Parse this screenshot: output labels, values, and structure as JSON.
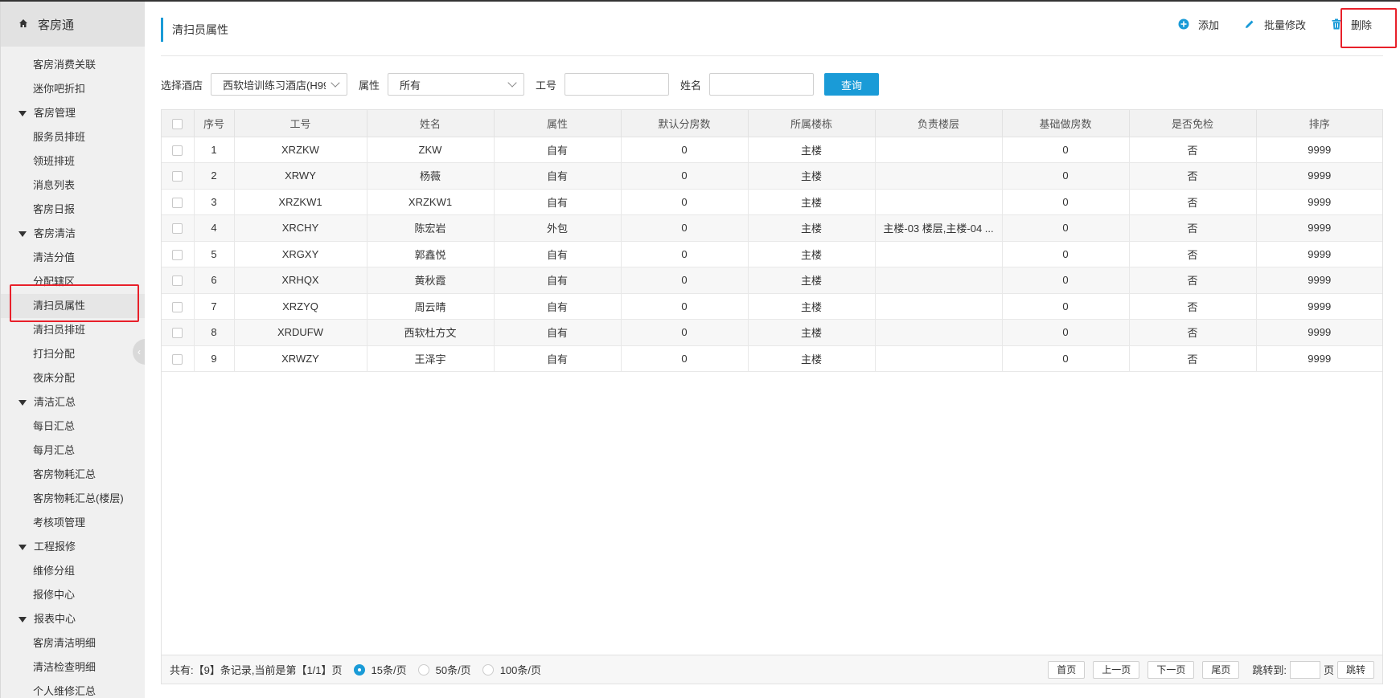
{
  "app": {
    "title": "客房通"
  },
  "sidebar": {
    "entries": [
      {
        "type": "item",
        "label": "客房消费关联"
      },
      {
        "type": "item",
        "label": "迷你吧折扣"
      },
      {
        "type": "group",
        "label": "客房管理"
      },
      {
        "type": "item",
        "label": "服务员排班"
      },
      {
        "type": "item",
        "label": "领班排班"
      },
      {
        "type": "item",
        "label": "消息列表"
      },
      {
        "type": "item",
        "label": "客房日报"
      },
      {
        "type": "group",
        "label": "客房清洁"
      },
      {
        "type": "item",
        "label": "清洁分值"
      },
      {
        "type": "item",
        "label": "分配辖区"
      },
      {
        "type": "item",
        "label": "清扫员属性",
        "active": true
      },
      {
        "type": "item",
        "label": "清扫员排班"
      },
      {
        "type": "item",
        "label": "打扫分配"
      },
      {
        "type": "item",
        "label": "夜床分配"
      },
      {
        "type": "group",
        "label": "清洁汇总"
      },
      {
        "type": "item",
        "label": "每日汇总"
      },
      {
        "type": "item",
        "label": "每月汇总"
      },
      {
        "type": "item",
        "label": "客房物耗汇总"
      },
      {
        "type": "item",
        "label": "客房物耗汇总(楼层)"
      },
      {
        "type": "item",
        "label": "考核项管理"
      },
      {
        "type": "group",
        "label": "工程报修"
      },
      {
        "type": "item",
        "label": "维修分组"
      },
      {
        "type": "item",
        "label": "报修中心"
      },
      {
        "type": "group",
        "label": "报表中心"
      },
      {
        "type": "item",
        "label": "客房清洁明细"
      },
      {
        "type": "item",
        "label": "清洁检查明细"
      },
      {
        "type": "item",
        "label": "个人维修汇总"
      }
    ]
  },
  "page": {
    "title": "清扫员属性"
  },
  "toolbar": {
    "add_label": "添加",
    "batch_edit_label": "批量修改",
    "delete_label": "删除",
    "accent": "#1a9bd7"
  },
  "filters": {
    "hotel_label": "选择酒店",
    "hotel_value": "西软培训练习酒店(H99",
    "attr_label": "属性",
    "attr_value": "所有",
    "id_label": "工号",
    "id_value": "",
    "name_label": "姓名",
    "name_value": "",
    "query_label": "查询"
  },
  "table": {
    "columns": [
      "序号",
      "工号",
      "姓名",
      "属性",
      "默认分房数",
      "所属楼栋",
      "负责楼层",
      "基础做房数",
      "是否免检",
      "排序"
    ],
    "rows": [
      [
        "1",
        "XRZKW",
        "ZKW",
        "自有",
        "0",
        "主楼",
        "",
        "0",
        "否",
        "9999"
      ],
      [
        "2",
        "XRWY",
        "杨薇",
        "自有",
        "0",
        "主楼",
        "",
        "0",
        "否",
        "9999"
      ],
      [
        "3",
        "XRZKW1",
        "XRZKW1",
        "自有",
        "0",
        "主楼",
        "",
        "0",
        "否",
        "9999"
      ],
      [
        "4",
        "XRCHY",
        "陈宏岩",
        "外包",
        "0",
        "主楼",
        "主楼-03 楼层,主楼-04 ...",
        "0",
        "否",
        "9999"
      ],
      [
        "5",
        "XRGXY",
        "郭鑫悦",
        "自有",
        "0",
        "主楼",
        "",
        "0",
        "否",
        "9999"
      ],
      [
        "6",
        "XRHQX",
        "黄秋霞",
        "自有",
        "0",
        "主楼",
        "",
        "0",
        "否",
        "9999"
      ],
      [
        "7",
        "XRZYQ",
        "周云晴",
        "自有",
        "0",
        "主楼",
        "",
        "0",
        "否",
        "9999"
      ],
      [
        "8",
        "XRDUFW",
        "西软杜方文",
        "自有",
        "0",
        "主楼",
        "",
        "0",
        "否",
        "9999"
      ],
      [
        "9",
        "XRWZY",
        "王泽宇",
        "自有",
        "0",
        "主楼",
        "",
        "0",
        "否",
        "9999"
      ]
    ]
  },
  "footer": {
    "summary": "共有:【9】条记录,当前是第【1/1】页",
    "page_size_options": [
      "15条/页",
      "50条/页",
      "100条/页"
    ],
    "selected_page_size": "15条/页",
    "first": "首页",
    "prev": "上一页",
    "next": "下一页",
    "last": "尾页",
    "jump_label": "跳转到:",
    "page_unit": "页",
    "jump_btn": "跳转"
  }
}
